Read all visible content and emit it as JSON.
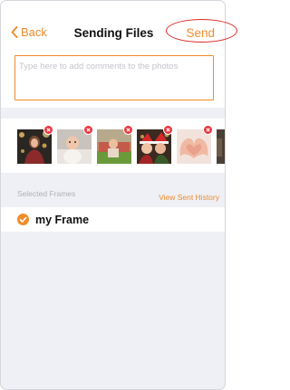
{
  "navbar": {
    "back_label": "Back",
    "title": "Sending Files",
    "send_label": "Send"
  },
  "comments": {
    "placeholder": "Type here to add comments to the photos"
  },
  "photos": [
    {
      "subject": "woman with bokeh lights"
    },
    {
      "subject": "baby on white blanket"
    },
    {
      "subject": "child on grass with picnic"
    },
    {
      "subject": "kids in santa hats"
    },
    {
      "subject": "hands forming heart"
    },
    {
      "subject": "partially visible photo"
    }
  ],
  "frames_section": {
    "label": "Selected Frames",
    "history_link": "View Sent History"
  },
  "frames": [
    {
      "name": "my Frame",
      "selected": true
    }
  ],
  "colors": {
    "accent": "#f08c2c",
    "remove_badge": "#e8373f",
    "annotation": "#dd2a2a",
    "background": "#eef0f5"
  }
}
